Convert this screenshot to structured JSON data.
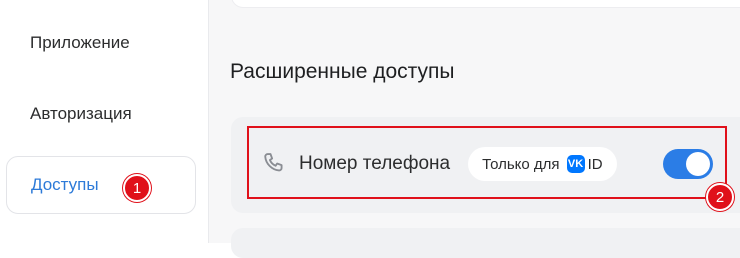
{
  "sidebar": {
    "items": [
      {
        "label": "Приложение"
      },
      {
        "label": "Авторизация"
      },
      {
        "label": "Доступы"
      }
    ]
  },
  "badges": {
    "first": "1",
    "second": "2"
  },
  "main": {
    "section_title": "Расширенные доступы",
    "permission": {
      "icon": "phone-icon",
      "label": "Номер телефона",
      "only_for_label": "Только для",
      "vk_logo_text": "VK",
      "id_label": "ID",
      "enabled": true
    }
  },
  "colors": {
    "accent": "#2c7ad8",
    "toggle_on": "#2b7de6",
    "highlight": "#e0101a",
    "vk_blue": "#0077ff"
  }
}
